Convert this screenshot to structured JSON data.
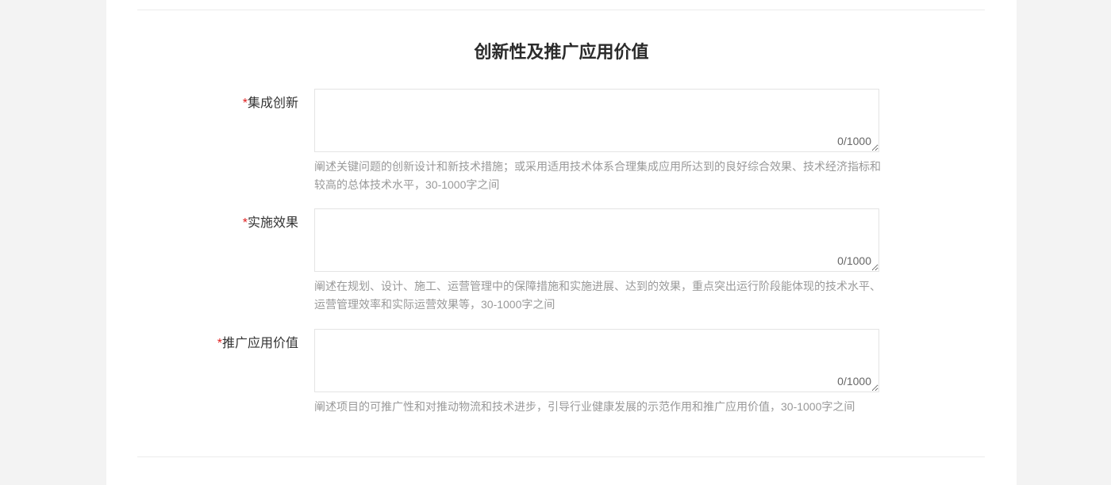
{
  "section": {
    "title": "创新性及推广应用价值"
  },
  "fields": [
    {
      "required_mark": "*",
      "label": "集成创新",
      "value": "",
      "counter": "0/1000",
      "help": "阐述关键问题的创新设计和新技术措施；或采用适用技术体系合理集成应用所达到的良好综合效果、技术经济指标和较高的总体技术水平，30-1000字之间"
    },
    {
      "required_mark": "*",
      "label": "实施效果",
      "value": "",
      "counter": "0/1000",
      "help": "阐述在规划、设计、施工、运营管理中的保障措施和实施进展、达到的效果，重点突出运行阶段能体现的技术水平、运营管理效率和实际运营效果等，30-1000字之间"
    },
    {
      "required_mark": "*",
      "label": "推广应用价值",
      "value": "",
      "counter": "0/1000",
      "help": "阐述项目的可推广性和对推动物流和技术进步，引导行业健康发展的示范作用和推广应用价值，30-1000字之间"
    }
  ],
  "colors": {
    "required": "#e02020",
    "help": "#999999",
    "label": "#333333"
  }
}
